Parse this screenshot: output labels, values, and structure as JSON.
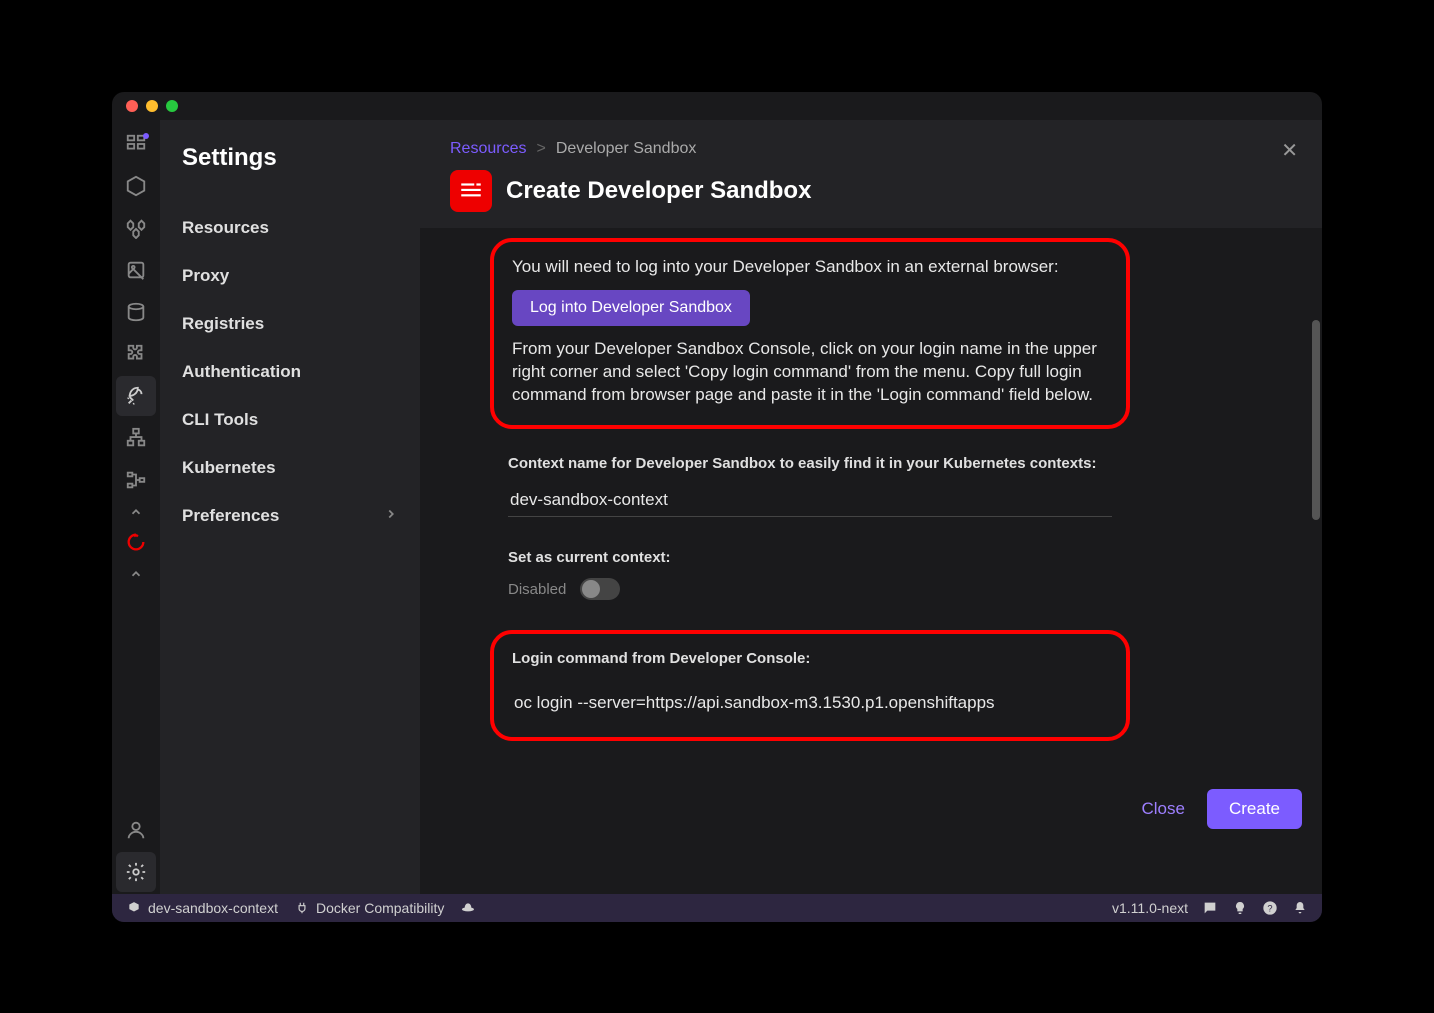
{
  "sidebar": {
    "title": "Settings",
    "items": [
      {
        "label": "Resources"
      },
      {
        "label": "Proxy"
      },
      {
        "label": "Registries"
      },
      {
        "label": "Authentication"
      },
      {
        "label": "CLI Tools"
      },
      {
        "label": "Kubernetes"
      },
      {
        "label": "Preferences",
        "hasChevron": true
      }
    ]
  },
  "breadcrumb": {
    "link": "Resources",
    "sep": ">",
    "current": "Developer Sandbox"
  },
  "page": {
    "title": "Create Developer Sandbox"
  },
  "info": {
    "text1": "You will need to log into your Developer Sandbox in an external browser:",
    "loginBtn": "Log into Developer Sandbox",
    "text2": "From your Developer Sandbox Console, click on your login name in the upper right corner and select 'Copy login command' from the menu. Copy full login command from browser page and paste it in the 'Login command' field below."
  },
  "fields": {
    "contextLabel": "Context name for Developer Sandbox to easily find it in your Kubernetes contexts:",
    "contextValue": "dev-sandbox-context",
    "setCurrentLabel": "Set as current context:",
    "setCurrentState": "Disabled",
    "loginCmdLabel": "Login command from Developer Console:",
    "loginCmdValue": "oc login --server=https://api.sandbox-m3.1530.p1.openshiftapps"
  },
  "actions": {
    "close": "Close",
    "create": "Create"
  },
  "statusbar": {
    "context": "dev-sandbox-context",
    "docker": "Docker Compatibility",
    "version": "v1.11.0-next"
  }
}
